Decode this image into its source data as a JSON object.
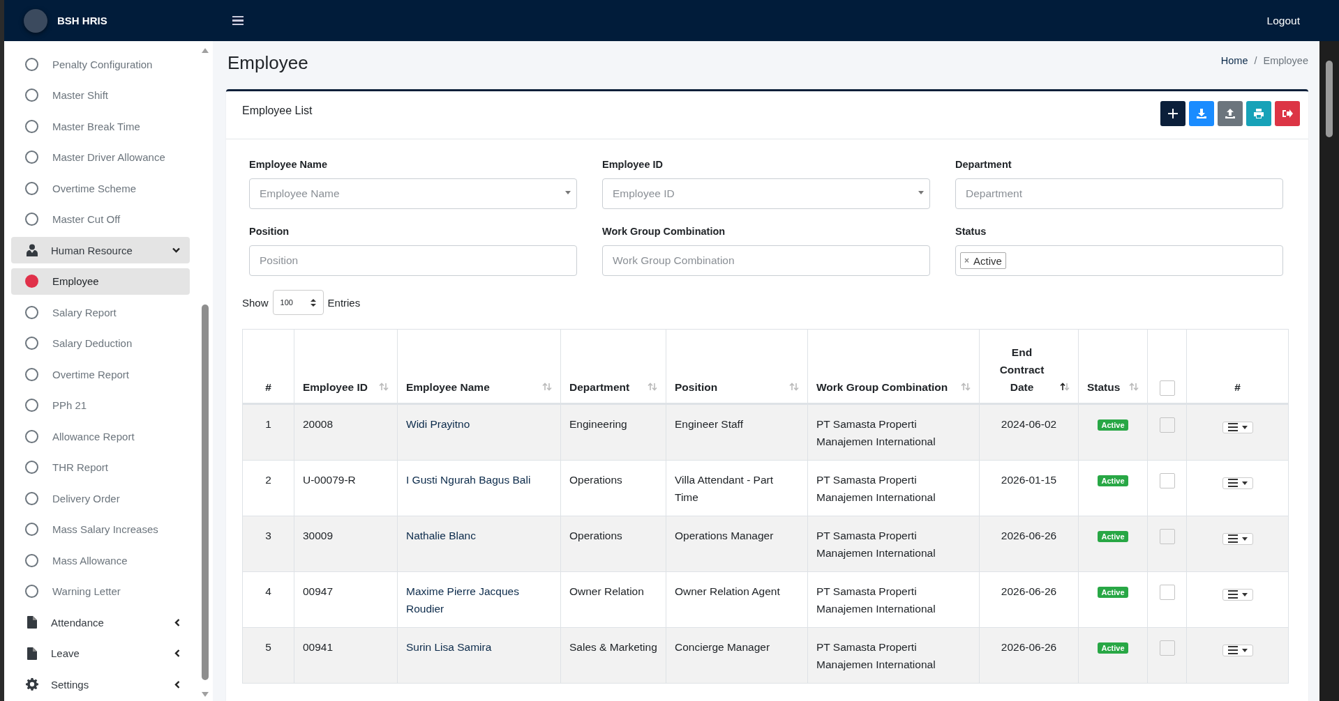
{
  "app": {
    "brand": "BSH HRIS",
    "logout": "Logout"
  },
  "sidebar": {
    "items": [
      {
        "label": "Penalty Configuration",
        "kind": "link",
        "selected": false
      },
      {
        "label": "Master Shift",
        "kind": "link",
        "selected": false
      },
      {
        "label": "Master Break Time",
        "kind": "link",
        "selected": false
      },
      {
        "label": "Master Driver Allowance",
        "kind": "link",
        "selected": false
      },
      {
        "label": "Overtime Scheme",
        "kind": "link",
        "selected": false
      },
      {
        "label": "Master Cut Off",
        "kind": "link",
        "selected": false
      },
      {
        "label": "Human Resource",
        "kind": "people",
        "expanded": true,
        "selected": true
      },
      {
        "label": "Employee",
        "kind": "link",
        "selected": true
      },
      {
        "label": "Salary Report",
        "kind": "link",
        "selected": false
      },
      {
        "label": "Salary Deduction",
        "kind": "link",
        "selected": false
      },
      {
        "label": "Overtime Report",
        "kind": "link",
        "selected": false
      },
      {
        "label": "PPh 21",
        "kind": "link",
        "selected": false
      },
      {
        "label": "Allowance Report",
        "kind": "link",
        "selected": false
      },
      {
        "label": "THR Report",
        "kind": "link",
        "selected": false
      },
      {
        "label": "Delivery Order",
        "kind": "link",
        "selected": false
      },
      {
        "label": "Mass Salary Increases",
        "kind": "link",
        "selected": false
      },
      {
        "label": "Mass Allowance",
        "kind": "link",
        "selected": false
      },
      {
        "label": "Warning Letter",
        "kind": "link",
        "selected": false
      },
      {
        "label": "Attendance",
        "kind": "document",
        "expanded": false,
        "selected": false
      },
      {
        "label": "Leave",
        "kind": "document",
        "expanded": false,
        "selected": false
      },
      {
        "label": "Settings",
        "kind": "settings",
        "expanded": false,
        "selected": false
      }
    ]
  },
  "page": {
    "title": "Employee",
    "breadcrumb": [
      {
        "label": "Home",
        "current": false
      },
      {
        "label": "/",
        "kind": "separator"
      },
      {
        "label": "Employee",
        "current": true
      }
    ]
  },
  "card": {
    "title": "Employee List",
    "actions": [
      {
        "kind": "add"
      },
      {
        "kind": "download"
      },
      {
        "kind": "upload"
      },
      {
        "kind": "print"
      },
      {
        "kind": "export"
      }
    ]
  },
  "filters": [
    {
      "label": "Employee Name",
      "placeholder": "Employee Name",
      "kind": "select"
    },
    {
      "label": "Employee ID",
      "placeholder": "Employee ID",
      "kind": "select"
    },
    {
      "label": "Department",
      "placeholder": "Department",
      "kind": "text"
    },
    {
      "label": "Position",
      "placeholder": "Position",
      "kind": "text"
    },
    {
      "label": "Work Group Combination",
      "placeholder": "Work Group Combination",
      "kind": "text"
    },
    {
      "label": "Status",
      "kind": "tags",
      "tags": [
        {
          "remove": "×",
          "label": "Active"
        }
      ]
    }
  ],
  "page_length": {
    "before": "Show",
    "value": "100",
    "after": "Entries"
  },
  "table": {
    "columns": [
      {
        "kind": "text",
        "label": "#"
      },
      {
        "kind": "text",
        "label": "Employee ID",
        "sorted": false
      },
      {
        "kind": "text",
        "label": "Employee Name",
        "sorted": false
      },
      {
        "kind": "text",
        "label": "Department",
        "sorted": false
      },
      {
        "kind": "text",
        "label": "Position",
        "sorted": false
      },
      {
        "kind": "text",
        "label": "Work Group Combination",
        "sorted": false
      },
      {
        "kind": "text",
        "label": "End Contract Date",
        "sorted": true
      },
      {
        "kind": "text",
        "label": "Status",
        "sorted": false
      },
      {
        "kind": "checkbox",
        "checked": false
      },
      {
        "kind": "text",
        "label": "#"
      }
    ],
    "rows": [
      {
        "no": "1",
        "employee_id": "20008",
        "name": "Widi Prayitno",
        "department": "Engineering",
        "position": "Engineer Staff",
        "work_group": "PT Samasta Properti Manajemen International",
        "end_date": "2024-06-02",
        "status": "Active",
        "checked": false
      },
      {
        "no": "2",
        "employee_id": "U-00079-R",
        "name": "I Gusti Ngurah Bagus Bali",
        "department": "Operations",
        "position": "Villa Attendant - Part Time",
        "work_group": "PT Samasta Properti Manajemen International",
        "end_date": "2026-01-15",
        "status": "Active",
        "checked": false
      },
      {
        "no": "3",
        "employee_id": "30009",
        "name": "Nathalie Blanc",
        "department": "Operations",
        "position": "Operations Manager",
        "work_group": "PT Samasta Properti Manajemen International",
        "end_date": "2026-06-26",
        "status": "Active",
        "checked": false
      },
      {
        "no": "4",
        "employee_id": "00947",
        "name": "Maxime Pierre Jacques Roudier",
        "department": "Owner Relation",
        "position": "Owner Relation Agent",
        "work_group": "PT Samasta Properti Manajemen International",
        "end_date": "2026-06-26",
        "status": "Active",
        "checked": false
      },
      {
        "no": "5",
        "employee_id": "00941",
        "name": "Surin Lisa Samira",
        "department": "Sales & Marketing",
        "position": "Concierge Manager",
        "work_group": "PT Samasta Properti Manajemen International",
        "end_date": "2026-06-26",
        "status": "Active",
        "checked": false
      }
    ]
  }
}
